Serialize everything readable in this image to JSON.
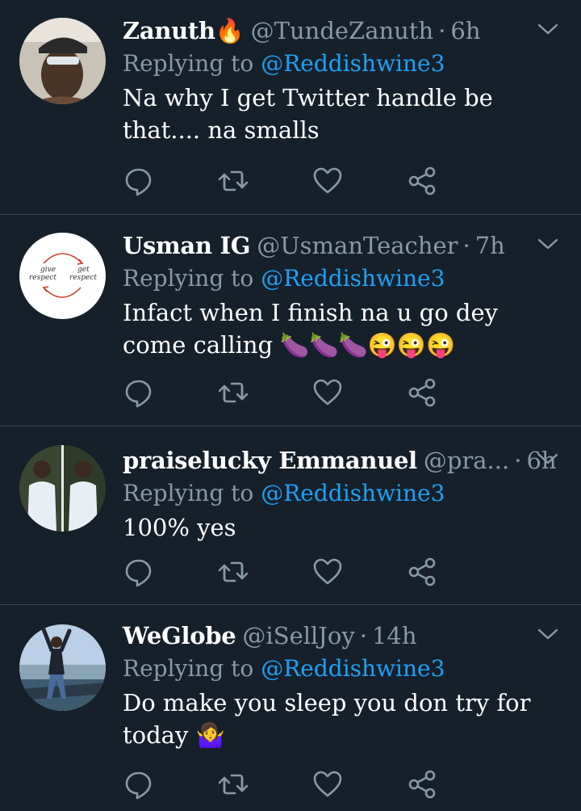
{
  "tweets": [
    {
      "name": "Zanuth🔥",
      "handle": "@TundeZanuth",
      "time": "6h",
      "replying_prefix": "Replying to",
      "replying_handle": "@Reddishwine3",
      "text": "Na why I get Twitter handle be that.... na smalls",
      "avatar": "avatar-man-sunglasses"
    },
    {
      "name": "Usman IG",
      "handle": "@UsmanTeacher",
      "time": "7h",
      "replying_prefix": "Replying to",
      "replying_handle": "@Reddishwine3",
      "text": "Infact when I finish na u go dey come calling 🍆🍆🍆😜😜😜",
      "avatar": "avatar-respect-cycle",
      "avatar_text": [
        "give",
        "respect",
        "get",
        "respect"
      ]
    },
    {
      "name": "praiselucky Emmanuel",
      "handle": "@pra...",
      "time": "6h",
      "replying_prefix": "Replying to",
      "replying_handle": "@Reddishwine3",
      "text": "100% yes",
      "avatar": "avatar-two-men"
    },
    {
      "name": "WeGlobe",
      "handle": "@iSellJoy",
      "time": "14h",
      "replying_prefix": "Replying to",
      "replying_handle": "@Reddishwine3",
      "text": "Do make you sleep you don try for today 🤷‍♀️",
      "avatar": "avatar-man-seaside"
    }
  ],
  "icons": [
    "reply-icon",
    "retweet-icon",
    "like-icon",
    "share-icon",
    "chevron-down-icon"
  ],
  "colors": {
    "background": "#15202b",
    "divider": "#38444d",
    "secondary_text": "#8899a6",
    "link": "#1da1f2",
    "primary_text": "#ffffff"
  }
}
